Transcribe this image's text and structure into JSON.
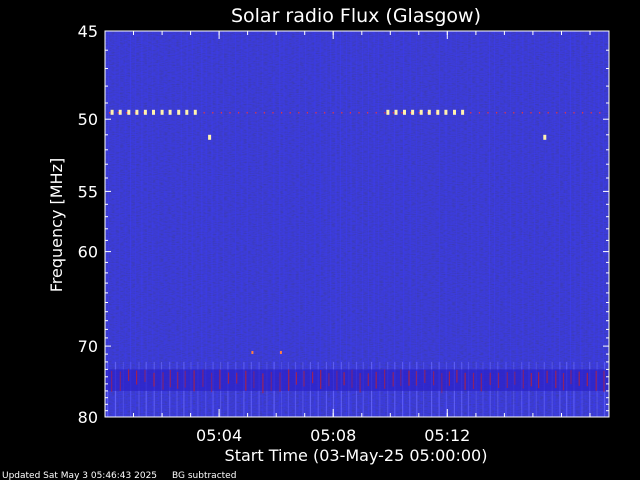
{
  "chart_data": {
    "type": "heatmap",
    "title": "Solar radio Flux (Glasgow)",
    "xlabel": "Start Time (03-May-25 05:00:00)",
    "ylabel": "Frequency [MHz]",
    "x_unit": "UT time",
    "xlim": [
      "05:00:00",
      "05:17:40"
    ],
    "ylim": [
      80,
      45
    ],
    "y_ticks": [
      45,
      50,
      55,
      60,
      70,
      80
    ],
    "x_ticks": [
      "05:04",
      "05:08",
      "05:12"
    ],
    "background_color": "#1a1ab0",
    "interference_band": {
      "freq_range": [
        73,
        76
      ],
      "color": "#c02030"
    },
    "persistent_signal": {
      "freq": 49.6,
      "color": "#ff3030"
    },
    "bright_markers": [
      {
        "time": "05:00:15",
        "freq": 49.6
      },
      {
        "time": "05:00:32",
        "freq": 49.6
      },
      {
        "time": "05:00:50",
        "freq": 49.6
      },
      {
        "time": "05:01:07",
        "freq": 49.6
      },
      {
        "time": "05:01:25",
        "freq": 49.6
      },
      {
        "time": "05:01:42",
        "freq": 49.6
      },
      {
        "time": "05:02:00",
        "freq": 49.6
      },
      {
        "time": "05:02:17",
        "freq": 49.6
      },
      {
        "time": "05:02:35",
        "freq": 49.6
      },
      {
        "time": "05:02:52",
        "freq": 49.6
      },
      {
        "time": "05:03:10",
        "freq": 49.6
      },
      {
        "time": "05:03:40",
        "freq": 51.2
      },
      {
        "time": "05:09:55",
        "freq": 49.6
      },
      {
        "time": "05:10:12",
        "freq": 49.6
      },
      {
        "time": "05:10:30",
        "freq": 49.6
      },
      {
        "time": "05:10:47",
        "freq": 49.6
      },
      {
        "time": "05:11:05",
        "freq": 49.6
      },
      {
        "time": "05:11:22",
        "freq": 49.6
      },
      {
        "time": "05:11:40",
        "freq": 49.6
      },
      {
        "time": "05:11:57",
        "freq": 49.6
      },
      {
        "time": "05:12:15",
        "freq": 49.6
      },
      {
        "time": "05:12:32",
        "freq": 49.6
      },
      {
        "time": "05:15:25",
        "freq": 51.2
      }
    ],
    "faint_dots": [
      {
        "time": "05:05:10",
        "freq": 70.8
      },
      {
        "time": "05:06:10",
        "freq": 70.8
      }
    ]
  },
  "footer": {
    "updated": "Updated Sat May  3 05:46:43 2025",
    "note": "BG subtracted"
  }
}
